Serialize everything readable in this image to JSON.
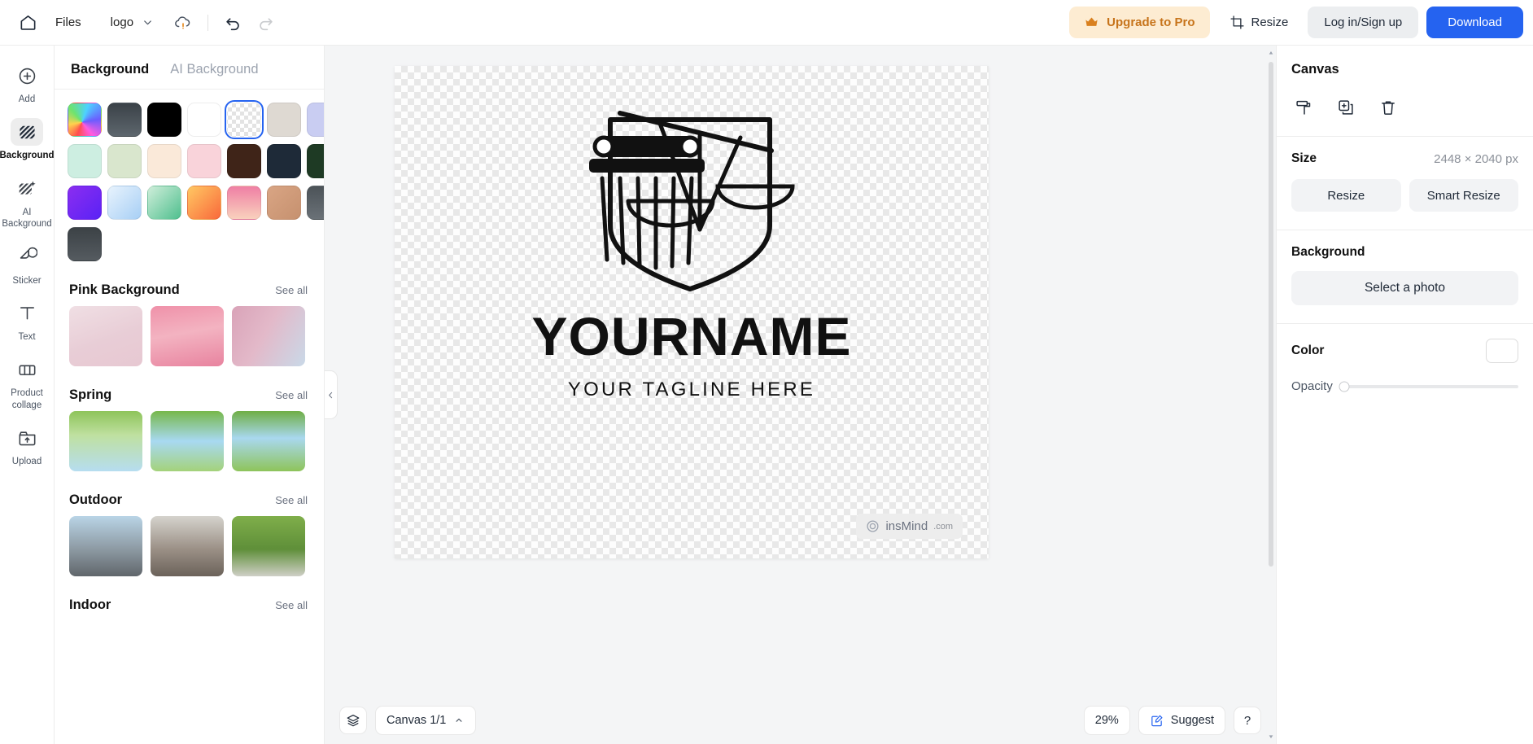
{
  "topbar": {
    "home_icon": "home-icon",
    "files_label": "Files",
    "doc_name": "logo",
    "cloud_icon": "cloud-warning-icon",
    "undo_icon": "undo-icon",
    "redo_icon": "redo-icon",
    "upgrade_label": "Upgrade to Pro",
    "crown_icon": "crown-icon",
    "resize_label": "Resize",
    "resize_icon": "crop-resize-icon",
    "login_label": "Log in/Sign up",
    "download_label": "Download",
    "accent_blue": "#2563f0",
    "upgrade_bg": "#fdecd2",
    "upgrade_fg": "#c7741b"
  },
  "rail": {
    "items": [
      {
        "label": "Add",
        "icon": "plus-circle-icon",
        "active": false
      },
      {
        "label": "Background",
        "icon": "stripes-icon",
        "active": true
      },
      {
        "label": "AI Background",
        "icon": "stripes-sparkle-icon",
        "active": false
      },
      {
        "label": "Sticker",
        "icon": "sticker-icon",
        "active": false
      },
      {
        "label": "Text",
        "icon": "text-t-icon",
        "active": false
      },
      {
        "label": "Product collage",
        "icon": "collage-icon",
        "active": false
      },
      {
        "label": "Upload",
        "icon": "upload-folder-icon",
        "active": false
      }
    ]
  },
  "panel": {
    "tabs": [
      {
        "label": "Background",
        "active": true
      },
      {
        "label": "AI Background",
        "active": false
      }
    ],
    "swatches": [
      {
        "name": "rainbow-gradient",
        "selected": false,
        "css": "conic-gradient(from 200deg at 42% 58%, #ff4d4d, #ffd24d, #6ee36e, #4dd2ff, #6b5cff, #ff5ce0, #ff4d4d)"
      },
      {
        "name": "dark-gray-gradient",
        "selected": false,
        "css": "linear-gradient(180deg,#3b4248,#5d666d)"
      },
      {
        "name": "black",
        "selected": false,
        "css": "#000000"
      },
      {
        "name": "white",
        "selected": false,
        "css": "#ffffff"
      },
      {
        "name": "transparent",
        "selected": true,
        "css": "checker"
      },
      {
        "name": "beige",
        "selected": false,
        "css": "#ded9d2"
      },
      {
        "name": "lavender",
        "selected": false,
        "css": "#c9cdf2"
      },
      {
        "name": "mint",
        "selected": false,
        "css": "#cdeee1"
      },
      {
        "name": "sage",
        "selected": false,
        "css": "#d9e6cd"
      },
      {
        "name": "cream",
        "selected": false,
        "css": "#fae9d9"
      },
      {
        "name": "blush-pink",
        "selected": false,
        "css": "#f9d3da"
      },
      {
        "name": "dark-brown",
        "selected": false,
        "css": "#3f2418"
      },
      {
        "name": "navy-charcoal",
        "selected": false,
        "css": "#1e2a38"
      },
      {
        "name": "forest-green",
        "selected": false,
        "css": "#1e3a24"
      },
      {
        "name": "purple-gradient",
        "selected": false,
        "css": "linear-gradient(135deg,#8b2ef0,#5a22f5)"
      },
      {
        "name": "light-blue-gradient",
        "selected": false,
        "css": "linear-gradient(135deg,#e8f3fd,#a7cff5)"
      },
      {
        "name": "green-gradient",
        "selected": false,
        "css": "linear-gradient(135deg,#cfeeda,#4fbf8e)"
      },
      {
        "name": "orange-gradient",
        "selected": false,
        "css": "linear-gradient(135deg,#ffc863,#f9693b)"
      },
      {
        "name": "pink-gradient",
        "selected": false,
        "css": "linear-gradient(180deg,#ef7fa4,#f9d1bd)"
      },
      {
        "name": "tan-gradient",
        "selected": false,
        "css": "linear-gradient(135deg,#d9a584,#c6916f)"
      },
      {
        "name": "slate-gray-gradient",
        "selected": false,
        "css": "linear-gradient(180deg,#4c5358,#6a7177)"
      },
      {
        "name": "charcoal-gradient",
        "selected": false,
        "css": "linear-gradient(180deg,#3c4246,#555b60)"
      }
    ],
    "sections": [
      {
        "title": "Pink Background",
        "see_all": "See all",
        "thumbs": [
          {
            "name": "pink-blossom-wall",
            "css": "linear-gradient(160deg,#f0dfe4 0%,#e8cdd6 55%,#e7c8d2 100%)"
          },
          {
            "name": "pink-floral-podium",
            "css": "linear-gradient(170deg,#ef91a9 0%,#f3b3c1 45%,#e8839f 100%)"
          },
          {
            "name": "pink-window-curtain",
            "css": "linear-gradient(120deg,#d9a3b8 0%,#e3b9c9 45%,#c9d9e8 100%)"
          }
        ]
      },
      {
        "title": "Spring",
        "see_all": "See all",
        "thumbs": [
          {
            "name": "spring-green-leaves-sky",
            "css": "linear-gradient(180deg,#8ec45a 0%,#bfe0a0 40%,#b6ddf0 100%)"
          },
          {
            "name": "spring-branch-blue-sky",
            "css": "linear-gradient(180deg,#77b84b 0%,#a8d9f2 50%,#a4d27a 100%)"
          },
          {
            "name": "spring-bench-meadow",
            "css": "linear-gradient(180deg,#6fae45 0%,#a9d8ef 45%,#8ec45a 100%)"
          }
        ]
      },
      {
        "title": "Outdoor",
        "see_all": "See all",
        "thumbs": [
          {
            "name": "outdoor-city-road",
            "css": "linear-gradient(180deg,#b9d4e6 0%,#8d9aa3 55%,#60666b 100%)"
          },
          {
            "name": "outdoor-paris-street",
            "css": "linear-gradient(180deg,#d5d3cd 0%,#9b9086 55%,#6b625a 100%)"
          },
          {
            "name": "outdoor-forest-path",
            "css": "linear-gradient(180deg,#7fae4a 0%,#5f8f39 55%,#cfcfc6 100%)"
          }
        ]
      },
      {
        "title": "Indoor",
        "see_all": "See all",
        "thumbs": []
      }
    ]
  },
  "canvas": {
    "logo_name": "YOURNAME",
    "logo_tagline": "YOUR TAGLINE HERE",
    "logo_icon": "pillar-scales-shield-icon",
    "watermark_text": "insMind",
    "watermark_suffix": ".com",
    "watermark_icon": "insmind-logo-icon"
  },
  "bottombar": {
    "layers_icon": "layers-icon",
    "canvas_label": "Canvas 1/1",
    "canvas_chevron_icon": "chevron-up-down-icon",
    "zoom_level": "29%",
    "suggest_label": "Suggest",
    "suggest_icon": "suggest-note-icon",
    "help_label": "?"
  },
  "right": {
    "title": "Canvas",
    "tools": [
      {
        "name": "paint-roller-icon",
        "label": "paint-roller"
      },
      {
        "name": "duplicate-icon",
        "label": "duplicate"
      },
      {
        "name": "trash-icon",
        "label": "delete"
      }
    ],
    "size_label": "Size",
    "size_value": "2448 × 2040 px",
    "resize_label": "Resize",
    "smart_resize_label": "Smart Resize",
    "background_label": "Background",
    "select_photo_label": "Select a photo",
    "color_label": "Color",
    "color_value": "#ffffff",
    "opacity_label": "Opacity",
    "opacity_value": 0
  }
}
